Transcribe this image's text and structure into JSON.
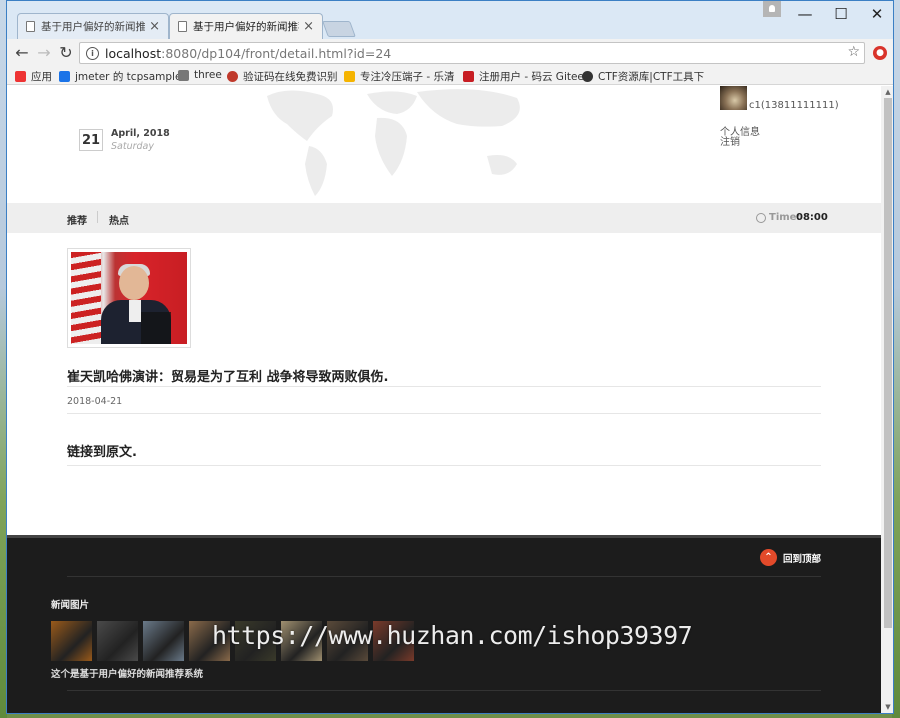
{
  "browser": {
    "tabs": [
      {
        "label": "基于用户偏好的新闻推荐",
        "close": "×"
      },
      {
        "label": "基于用户偏好的新闻推荐",
        "close": "×"
      }
    ],
    "window_controls": {
      "minimize": "—",
      "maximize": "☐",
      "close": "✕"
    },
    "url_host": "localhost",
    "url_rest": ":8080/dp104/front/detail.html?id=24",
    "bookmarks": [
      {
        "label": "应用",
        "icon": "apps-grid-icon",
        "color": "#e33"
      },
      {
        "label": "jmeter 的 tcpsample",
        "icon": "shield-icon",
        "color": "#1a73e8"
      },
      {
        "label": "three",
        "icon": "page-icon",
        "color": "#777"
      },
      {
        "label": "验证码在线免费识别",
        "icon": "cloud-icon",
        "color": "#c0392b"
      },
      {
        "label": "专注冷压端子 - 乐清",
        "icon": "hand-icon",
        "color": "#f5b400"
      },
      {
        "label": "注册用户 - 码云 Gitee",
        "icon": "gitee-icon",
        "color": "#c71d23"
      },
      {
        "label": "CTF资源库|CTF工具下",
        "icon": "hacker-icon",
        "color": "#333"
      }
    ]
  },
  "header": {
    "day": "21",
    "month_year": "April, 2018",
    "weekday": "Saturday",
    "user_name": "c1(13811111111)",
    "profile_link": "个人信息",
    "logout_link": "注销"
  },
  "nav": {
    "items": [
      "推荐",
      "热点"
    ],
    "time_label": "Time:",
    "time_value": "08:00"
  },
  "article": {
    "title": "崔天凯哈佛演讲：贸易是为了互利 战争将导致两败俱伤.",
    "date": "2018-04-21",
    "source_link": "链接到原文."
  },
  "footer": {
    "back_to_top": "回到顶部",
    "gallery_heading": "新闻图片",
    "thumb_colors": [
      "#9a5a1a",
      "#4a4a4a",
      "#6a7a8a",
      "#8a6a4a",
      "#3a3a2a",
      "#a09070",
      "#5a4a3a",
      "#7a3a2a"
    ],
    "description": "这个是基于用户偏好的新闻推荐系统"
  },
  "watermark": "https://www.huzhan.com/ishop39397",
  "colors": {
    "accent": "#e34a2a",
    "footer_bg": "#1c1c1c",
    "navbar_bg": "#eeeeee"
  }
}
